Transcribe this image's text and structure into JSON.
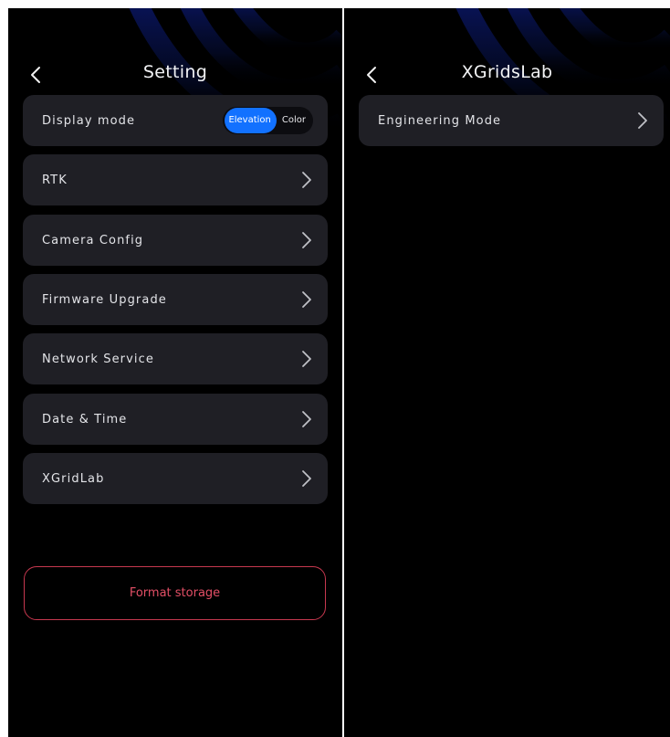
{
  "left_screen": {
    "title": "Setting",
    "display_mode": {
      "label": "Display mode",
      "options": [
        "Elevation",
        "Color"
      ],
      "selected": "Elevation"
    },
    "menu_items": [
      {
        "label": "RTK",
        "icon": "chevron-right-icon"
      },
      {
        "label": "Camera Config",
        "icon": "chevron-right-icon"
      },
      {
        "label": "Firmware Upgrade",
        "icon": "chevron-right-icon"
      },
      {
        "label": "Network Service",
        "icon": "chevron-right-icon"
      },
      {
        "label": "Date & Time",
        "icon": "chevron-right-icon"
      },
      {
        "label": "XGridLab",
        "icon": "chevron-right-icon"
      }
    ],
    "format_button": "Format storage"
  },
  "right_screen": {
    "title": "XGridsLab",
    "menu_items": [
      {
        "label": "Engineering Mode",
        "icon": "chevron-right-icon"
      }
    ]
  },
  "colors": {
    "background": "#000000",
    "card": "#1f1f25",
    "accent": "#1271ff",
    "danger": "#c7384f",
    "text": "#e3e4e8"
  },
  "icons": {
    "back": "chevron-left-icon",
    "row": "chevron-right-icon"
  }
}
